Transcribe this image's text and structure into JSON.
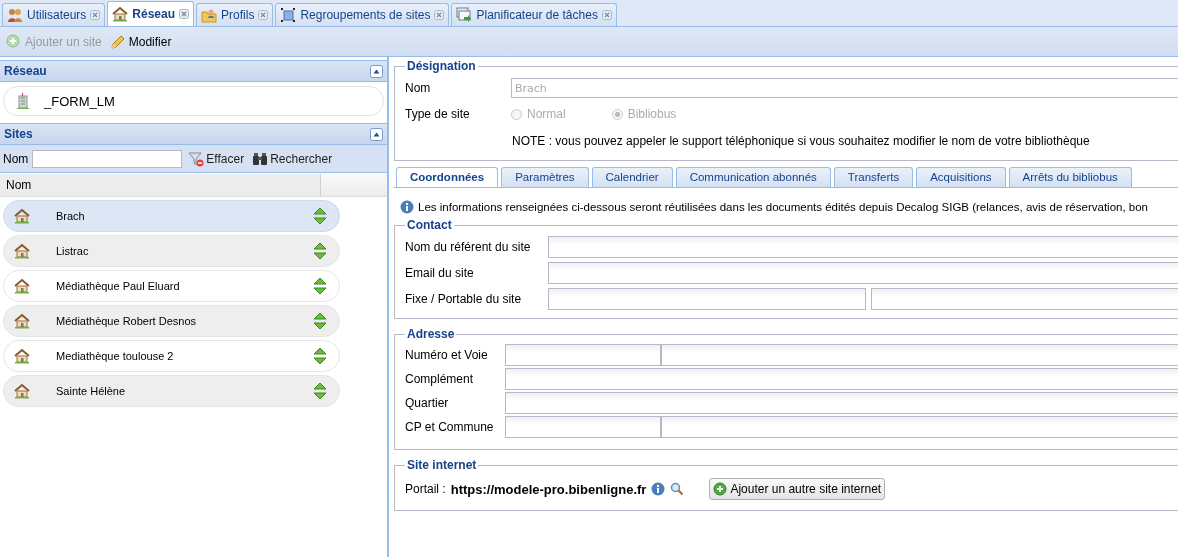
{
  "tabs": [
    {
      "label": "Utilisateurs",
      "selected": false
    },
    {
      "label": "Réseau",
      "selected": true
    },
    {
      "label": "Profils",
      "selected": false
    },
    {
      "label": "Regroupements de sites",
      "selected": false
    },
    {
      "label": "Planificateur de tâches",
      "selected": false
    }
  ],
  "toolbar": [
    {
      "label": "Ajouter un site",
      "disabled": true
    },
    {
      "label": "Modifier",
      "disabled": false
    }
  ],
  "network_panel": {
    "title": "Réseau",
    "item": "_FORM_LM"
  },
  "sites_panel": {
    "title": "Sites",
    "filter_label": "Nom",
    "clear": "Effacer",
    "search": "Rechercher",
    "column": "Nom",
    "rows": [
      {
        "name": "Brach",
        "selected": true
      },
      {
        "name": "Listrac",
        "selected": false
      },
      {
        "name": "Médiathèque Paul Eluard",
        "selected": false
      },
      {
        "name": "Médiathèque Robert Desnos",
        "selected": false
      },
      {
        "name": "Mediathèque toulouse 2",
        "selected": false
      },
      {
        "name": "Sainte Hélène",
        "selected": false
      }
    ]
  },
  "designation": {
    "legend": "Désignation",
    "name_label": "Nom",
    "name_value": "Brach",
    "type_label": "Type de site",
    "types": [
      {
        "label": "Normal",
        "selected": false
      },
      {
        "label": "Bibliobus",
        "selected": true
      }
    ],
    "note": "NOTE : vous pouvez appeler le support téléphonique si vous souhaitez modifier le nom de votre bibliothèque"
  },
  "detail_tabs": [
    {
      "label": "Coordonnées",
      "selected": true
    },
    {
      "label": "Paramètres",
      "selected": false
    },
    {
      "label": "Calendrier",
      "selected": false
    },
    {
      "label": "Communication abonnés",
      "selected": false
    },
    {
      "label": "Transferts",
      "selected": false
    },
    {
      "label": "Acquisitions",
      "selected": false
    },
    {
      "label": "Arrêts du bibliobus",
      "selected": false
    }
  ],
  "info": "Les informations renseignées ci-dessous seront réutilisées dans les documents édités depuis Decalog SIGB (relances, avis de réservation, bon",
  "contact": {
    "legend": "Contact",
    "fields": [
      {
        "label": "Nom du référent du site",
        "kind": "single"
      },
      {
        "label": "Email du site",
        "kind": "single"
      },
      {
        "label": "Fixe / Portable du site",
        "kind": "halves"
      }
    ]
  },
  "address": {
    "legend": "Adresse",
    "fields": [
      {
        "label": "Numéro et Voie",
        "kind": "short"
      },
      {
        "label": "Complément",
        "kind": "single"
      },
      {
        "label": "Quartier",
        "kind": "single"
      },
      {
        "label": "CP et Commune",
        "kind": "short"
      }
    ]
  },
  "website": {
    "legend": "Site internet",
    "label": "Portail :",
    "url": "https://modele-pro.bibenligne.fr",
    "button": "Ajouter un autre site internet"
  }
}
